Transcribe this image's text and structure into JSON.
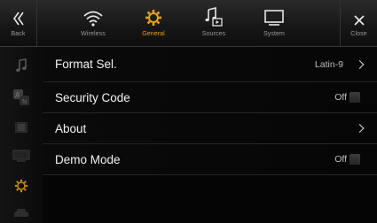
{
  "topbar": {
    "back_label": "Back",
    "close_label": "Close",
    "tabs": [
      {
        "label": "Wireless",
        "icon": "wifi-icon"
      },
      {
        "label": "General",
        "icon": "gear-icon",
        "active": true
      },
      {
        "label": "Sources",
        "icon": "music-source-icon"
      },
      {
        "label": "System",
        "icon": "monitor-icon"
      }
    ]
  },
  "rail": {
    "items": [
      "music-note-icon",
      "language-icon",
      "film-icon",
      "display-icon",
      "gear-icon",
      "car-icon"
    ],
    "active_index": 4
  },
  "list": {
    "rows": [
      {
        "label": "Format Sel.",
        "value": "Latin-9",
        "type": "chevron"
      },
      {
        "label": "Security Code",
        "value": "Off",
        "type": "toggle"
      },
      {
        "label": "About",
        "value": "",
        "type": "chevron"
      },
      {
        "label": "Demo Mode",
        "value": "Off",
        "type": "toggle"
      }
    ]
  },
  "colors": {
    "accent": "#e9a315",
    "text": "#f2f2f2",
    "muted": "#9a9a9a"
  }
}
